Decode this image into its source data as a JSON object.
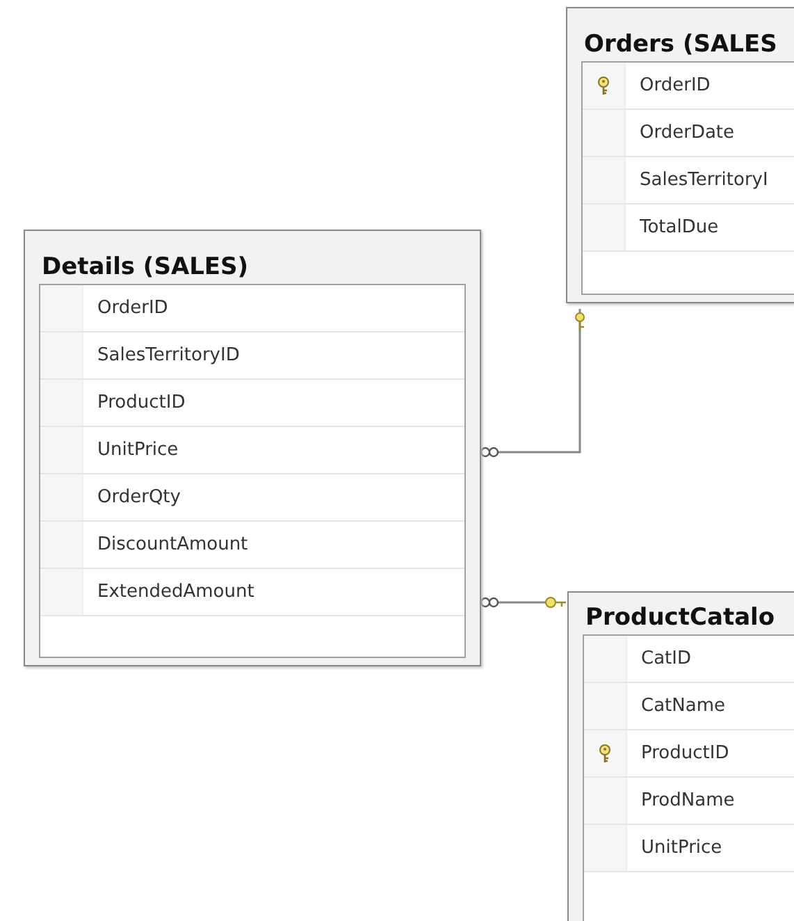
{
  "tables": [
    {
      "title": "Orders (SALES",
      "columns": [
        {
          "name": "OrderID",
          "primary_key": true
        },
        {
          "name": "OrderDate",
          "primary_key": false
        },
        {
          "name": "SalesTerritoryI",
          "primary_key": false
        },
        {
          "name": "TotalDue",
          "primary_key": false
        }
      ]
    },
    {
      "title": "Details (SALES)",
      "columns": [
        {
          "name": "OrderID",
          "primary_key": false
        },
        {
          "name": "SalesTerritoryID",
          "primary_key": false
        },
        {
          "name": "ProductID",
          "primary_key": false
        },
        {
          "name": "UnitPrice",
          "primary_key": false
        },
        {
          "name": "OrderQty",
          "primary_key": false
        },
        {
          "name": "DiscountAmount",
          "primary_key": false
        },
        {
          "name": "ExtendedAmount",
          "primary_key": false
        }
      ]
    },
    {
      "title": "ProductCatalo",
      "columns": [
        {
          "name": "CatID",
          "primary_key": false
        },
        {
          "name": "CatName",
          "primary_key": false
        },
        {
          "name": "ProductID",
          "primary_key": true
        },
        {
          "name": "ProdName",
          "primary_key": false
        },
        {
          "name": "UnitPrice",
          "primary_key": false
        }
      ]
    }
  ]
}
